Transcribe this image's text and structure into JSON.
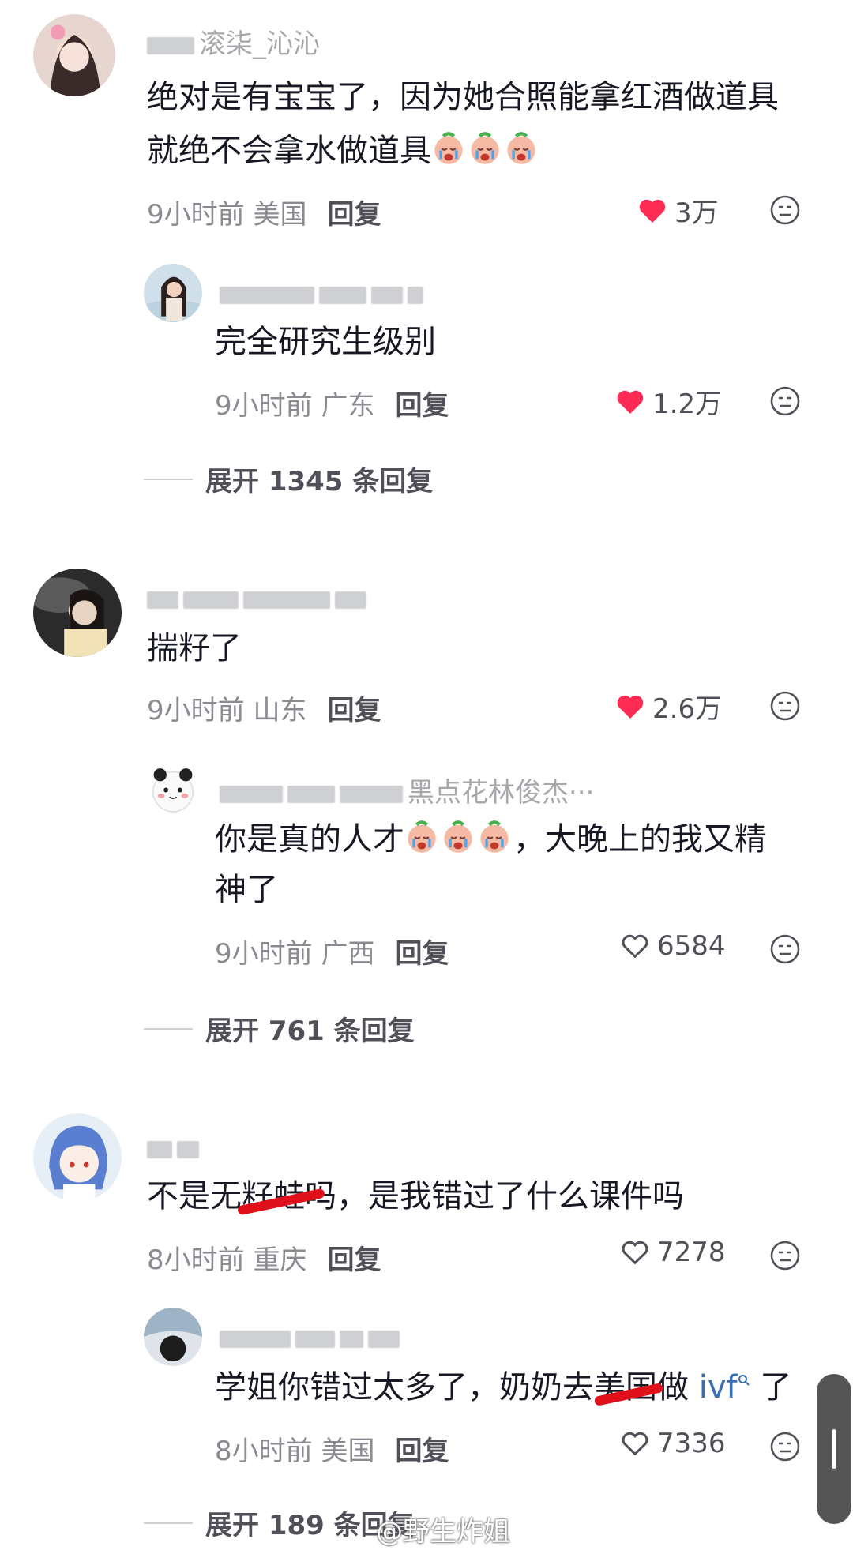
{
  "comments": [
    {
      "username": "滚柒_沁沁",
      "text_line1": "绝对是有宝宝了，因为她合照能拿红酒做道具",
      "text_line2": "就绝不会拿水做道具",
      "time": "9小时前",
      "location": "美国",
      "reply_label": "回复",
      "likes": "3万",
      "liked": true
    },
    {
      "username": "",
      "text": "完全研究生级别",
      "time": "9小时前",
      "location": "广东",
      "reply_label": "回复",
      "likes": "1.2万",
      "liked": true
    },
    {
      "expand": "展开 1345 条回复"
    },
    {
      "username": "",
      "text": "揣籽了",
      "time": "9小时前",
      "location": "山东",
      "reply_label": "回复",
      "likes": "2.6万",
      "liked": true
    },
    {
      "username": "黑点花林俊杰···",
      "text_line1": "你是真的人才",
      "text_line1b": "，大晚上的我又精",
      "text_line2": "神了",
      "time": "9小时前",
      "location": "广西",
      "reply_label": "回复",
      "likes": "6584",
      "liked": false
    },
    {
      "expand": "展开 761 条回复"
    },
    {
      "username": "",
      "text": "不是无籽蛙吗，是我错过了什么课件吗",
      "time": "8小时前",
      "location": "重庆",
      "reply_label": "回复",
      "likes": "7278",
      "liked": false
    },
    {
      "username": "",
      "text_a": "学姐你错过太多了，奶奶去美国做",
      "text_link": "ivf",
      "text_b": "了",
      "time": "8小时前",
      "location": "美国",
      "reply_label": "回复",
      "likes": "7336",
      "liked": false
    },
    {
      "expand": "展开 189 条回复"
    }
  ],
  "watermark": "@野生炸姐",
  "colors": {
    "heart_red": "#fe2c55",
    "meta_gray": "#8a8b91",
    "link_blue": "#3a6fb0"
  }
}
